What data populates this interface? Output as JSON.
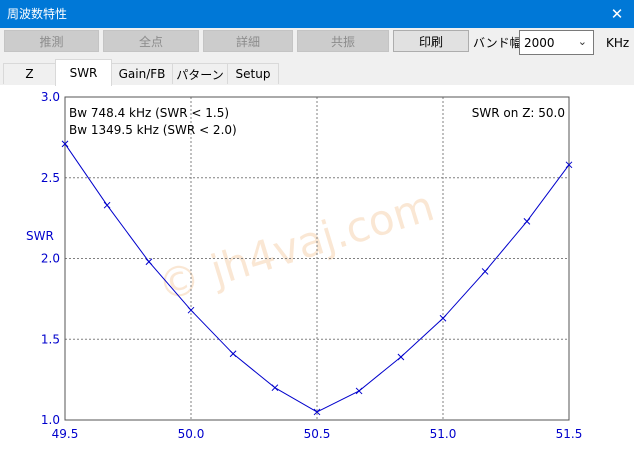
{
  "window": {
    "title": "周波数特性",
    "close_glyph": "✕"
  },
  "toolbar": {
    "buttons": [
      {
        "label": "推測",
        "enabled": false
      },
      {
        "label": "全点",
        "enabled": false
      },
      {
        "label": "詳細",
        "enabled": false
      },
      {
        "label": "共振",
        "enabled": false
      },
      {
        "label": "印刷",
        "enabled": true
      }
    ],
    "band_label": "バンド幅",
    "band_value": "2000",
    "unit": "KHz"
  },
  "tabs": [
    {
      "label": "Z",
      "active": false
    },
    {
      "label": "SWR",
      "active": true
    },
    {
      "label": "Gain/FB",
      "active": false
    },
    {
      "label": "パターン",
      "active": false
    },
    {
      "label": "Setup",
      "active": false
    }
  ],
  "chart_data": {
    "type": "line",
    "ylabel": "SWR",
    "xlabel": "",
    "xlim": [
      49.5,
      51.5
    ],
    "ylim": [
      1.0,
      3.0
    ],
    "x_ticks": [
      "49.5",
      "50.0",
      "50.5",
      "51.0",
      "51.5"
    ],
    "y_ticks": [
      "1.0",
      "1.5",
      "2.0",
      "2.5",
      "3.0"
    ],
    "grid": true,
    "annotations": [
      "Bw 748.4 kHz (SWR < 1.5)",
      "Bw 1349.5 kHz (SWR < 2.0)",
      "SWR on Z: 50.0"
    ],
    "watermark": "© jh4vaj.com",
    "series": [
      {
        "x": [
          49.5,
          49.667,
          49.833,
          50.0,
          50.167,
          50.333,
          50.5,
          50.667,
          50.833,
          51.0,
          51.167,
          51.333,
          51.5
        ],
        "y": [
          2.71,
          2.33,
          1.98,
          1.68,
          1.41,
          1.2,
          1.05,
          1.18,
          1.39,
          1.63,
          1.92,
          2.23,
          2.58
        ]
      }
    ],
    "colors": {
      "line": "#0000cc",
      "axis_text": "#0000cc",
      "grid": "#808080"
    }
  }
}
